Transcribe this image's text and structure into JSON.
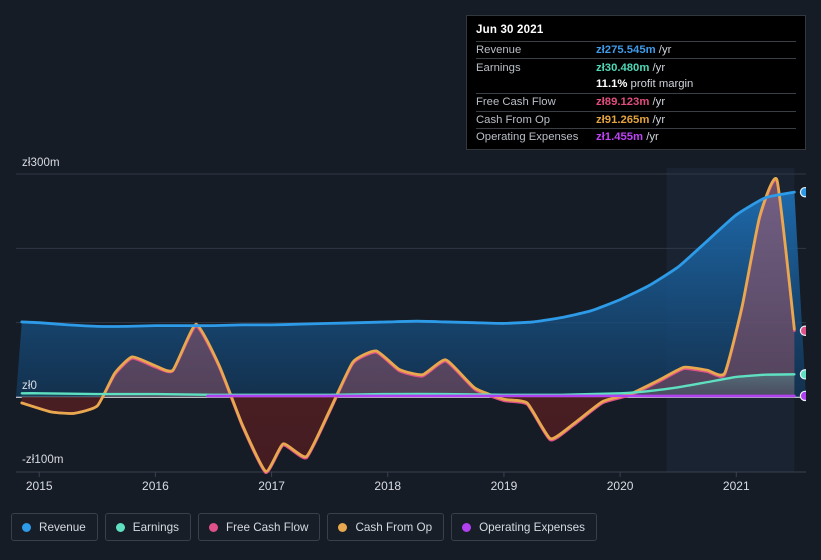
{
  "tooltip": {
    "date": "Jun 30 2021",
    "rows": [
      {
        "name": "Revenue",
        "value": "zł275.545m",
        "unit": "/yr",
        "color": "#3E9BE9"
      },
      {
        "name": "Earnings",
        "value": "zł30.480m",
        "unit": "/yr",
        "color": "#4FD8B6"
      },
      {
        "name": "",
        "value": "11.1%",
        "unit": "profit margin",
        "color": "#FFFFFF"
      },
      {
        "name": "Free Cash Flow",
        "value": "zł89.123m",
        "unit": "/yr",
        "color": "#E24D7E"
      },
      {
        "name": "Cash From Op",
        "value": "zł91.265m",
        "unit": "/yr",
        "color": "#E3A43F"
      },
      {
        "name": "Operating Expenses",
        "value": "zł1.455m",
        "unit": "/yr",
        "color": "#BE45F5"
      }
    ]
  },
  "legend": [
    {
      "label": "Revenue",
      "color": "#2E9BE8"
    },
    {
      "label": "Earnings",
      "color": "#5FE0C0"
    },
    {
      "label": "Free Cash Flow",
      "color": "#E0518A"
    },
    {
      "label": "Cash From Op",
      "color": "#E8A84E"
    },
    {
      "label": "Operating Expenses",
      "color": "#B040F0"
    }
  ],
  "axis": {
    "y_ticks": [
      {
        "label": "zł300m",
        "value": 300
      },
      {
        "label": "zł0",
        "value": 0
      },
      {
        "label": "-zł100m",
        "value": -100
      }
    ],
    "x_ticks": [
      "2015",
      "2016",
      "2017",
      "2018",
      "2019",
      "2020",
      "2021"
    ]
  },
  "chart_data": {
    "type": "area",
    "title": "",
    "xlabel": "",
    "ylabel": "",
    "currency": "zł",
    "unit": "m",
    "ylim": [
      -110,
      310
    ],
    "xlim": [
      2014.8,
      2021.6
    ],
    "grid": true,
    "legend_position": "bottom-left",
    "gridline_values": [
      300,
      200,
      100,
      0
    ],
    "series": [
      {
        "name": "Revenue",
        "color": "#2E9BE8",
        "filled": true,
        "x": [
          2014.85,
          2015.0,
          2015.25,
          2015.5,
          2015.75,
          2016.0,
          2016.25,
          2016.5,
          2016.75,
          2017.0,
          2017.25,
          2017.5,
          2017.75,
          2018.0,
          2018.25,
          2018.5,
          2018.75,
          2019.0,
          2019.25,
          2019.5,
          2019.75,
          2020.0,
          2020.25,
          2020.5,
          2020.75,
          2021.0,
          2021.25,
          2021.5
        ],
        "values": [
          101,
          100,
          97,
          95,
          95,
          96,
          96,
          96,
          97,
          97,
          98,
          99,
          100,
          101,
          102,
          101,
          100,
          99,
          101,
          107,
          116,
          131,
          150,
          175,
          210,
          245,
          268,
          275.545
        ]
      },
      {
        "name": "Earnings",
        "color": "#5FE0C0",
        "filled": true,
        "x": [
          2014.85,
          2015.0,
          2015.5,
          2016.0,
          2016.5,
          2017.0,
          2017.5,
          2018.0,
          2018.5,
          2019.0,
          2019.5,
          2020.0,
          2020.25,
          2020.5,
          2020.75,
          2021.0,
          2021.25,
          2021.5
        ],
        "values": [
          5,
          5,
          4,
          4,
          3,
          3,
          3,
          4,
          4,
          3,
          3,
          5,
          8,
          13,
          20,
          27,
          30,
          30.48
        ]
      },
      {
        "name": "Free Cash Flow",
        "color": "#E0518A",
        "filled": true,
        "x": [
          2014.85,
          2015.1,
          2015.3,
          2015.5,
          2015.65,
          2015.8,
          2016.0,
          2016.15,
          2016.35,
          2016.55,
          2016.75,
          2016.95,
          2017.1,
          2017.3,
          2017.5,
          2017.7,
          2017.9,
          2018.1,
          2018.3,
          2018.5,
          2018.75,
          2019.0,
          2019.2,
          2019.4,
          2019.6,
          2019.85,
          2020.1,
          2020.35,
          2020.55,
          2020.75,
          2020.9,
          2021.05,
          2021.2,
          2021.35,
          2021.5
        ],
        "values": [
          -8,
          -20,
          -22,
          -12,
          30,
          52,
          40,
          35,
          95,
          40,
          -40,
          -102,
          -65,
          -82,
          -20,
          45,
          60,
          35,
          28,
          48,
          10,
          -5,
          -10,
          -58,
          -38,
          -8,
          3,
          22,
          38,
          34,
          30,
          120,
          240,
          290,
          89.123
        ]
      },
      {
        "name": "Cash From Op",
        "color": "#E8A84E",
        "filled": false,
        "x": [
          2014.85,
          2015.1,
          2015.3,
          2015.5,
          2015.65,
          2015.8,
          2016.0,
          2016.15,
          2016.35,
          2016.55,
          2016.75,
          2016.95,
          2017.1,
          2017.3,
          2017.5,
          2017.7,
          2017.9,
          2018.1,
          2018.3,
          2018.5,
          2018.75,
          2019.0,
          2019.2,
          2019.4,
          2019.6,
          2019.85,
          2020.1,
          2020.35,
          2020.55,
          2020.75,
          2020.9,
          2021.05,
          2021.2,
          2021.35,
          2021.5
        ],
        "values": [
          -8,
          -20,
          -22,
          -12,
          32,
          54,
          42,
          36,
          98,
          42,
          -38,
          -100,
          -63,
          -80,
          -18,
          47,
          62,
          37,
          30,
          50,
          12,
          -3,
          -8,
          -56,
          -36,
          -6,
          5,
          24,
          40,
          36,
          32,
          122,
          242,
          292,
          91.265
        ]
      },
      {
        "name": "Operating Expenses",
        "color": "#B040F0",
        "filled": false,
        "x": [
          2016.45,
          2017.0,
          2018.0,
          2019.0,
          2020.0,
          2021.0,
          2021.5
        ],
        "values": [
          1.4,
          1.4,
          1.5,
          1.5,
          1.5,
          1.45,
          1.455
        ]
      }
    ],
    "end_markers": [
      {
        "series": "Revenue",
        "value": 275.545,
        "color": "#2E9BE8"
      },
      {
        "series": "Free Cash Flow",
        "value": 89.123,
        "color": "#E0518A"
      },
      {
        "series": "Earnings",
        "value": 30.48,
        "color": "#5FE0C0"
      },
      {
        "series": "Operating Expenses",
        "value": 1.455,
        "color": "#B040F0"
      }
    ],
    "highlight_band": {
      "from": 2020.4,
      "to": 2021.5
    }
  }
}
